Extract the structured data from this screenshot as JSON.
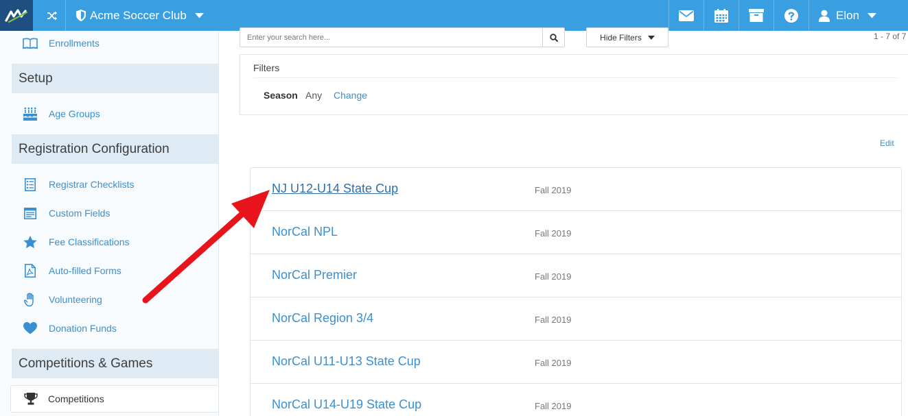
{
  "header": {
    "club_name": "Acme Soccer Club",
    "user_name": "Elon",
    "icons": [
      "shuffle-icon",
      "shield-icon",
      "envelope-icon",
      "calendar-icon",
      "archive-icon",
      "help-icon",
      "user-icon"
    ]
  },
  "sidebar": {
    "items_top": [
      {
        "label": "Enrollments",
        "icon": "book-icon"
      }
    ],
    "sections": [
      {
        "title": "Setup",
        "items": [
          {
            "label": "Age Groups",
            "icon": "cake-icon"
          }
        ]
      },
      {
        "title": "Registration Configuration",
        "items": [
          {
            "label": "Registrar Checklists",
            "icon": "checklist-icon"
          },
          {
            "label": "Custom Fields",
            "icon": "form-icon"
          },
          {
            "label": "Fee Classifications",
            "icon": "star-icon"
          },
          {
            "label": "Auto-filled Forms",
            "icon": "pdf-icon"
          },
          {
            "label": "Volunteering",
            "icon": "hand-icon"
          },
          {
            "label": "Donation Funds",
            "icon": "heart-icon"
          }
        ]
      },
      {
        "title": "Competitions & Games",
        "items": [
          {
            "label": "Competitions",
            "icon": "trophy-icon",
            "active": true
          }
        ]
      }
    ]
  },
  "search": {
    "placeholder": "Enter your search here..."
  },
  "filters_button": {
    "label": "Hide Filters"
  },
  "pagination": {
    "text": "1 - 7 of 7"
  },
  "filters": {
    "title": "Filters",
    "season_label": "Season",
    "season_value": "Any",
    "change_label": "Change"
  },
  "edit_label": "Edit",
  "competitions": [
    {
      "name": "NJ U12-U14 State Cup",
      "season": "Fall 2019"
    },
    {
      "name": "NorCal NPL",
      "season": "Fall 2019"
    },
    {
      "name": "NorCal Premier",
      "season": "Fall 2019"
    },
    {
      "name": "NorCal Region 3/4",
      "season": "Fall 2019"
    },
    {
      "name": "NorCal U11-U13 State Cup",
      "season": "Fall 2019"
    },
    {
      "name": "NorCal U14-U19 State Cup",
      "season": "Fall 2019"
    }
  ],
  "colors": {
    "topbar": "#3a9fe0",
    "logo_bg": "#1e4f80",
    "link": "#3a8fd1",
    "section_bg": "#deebf5",
    "arrow": "#e8141b"
  }
}
